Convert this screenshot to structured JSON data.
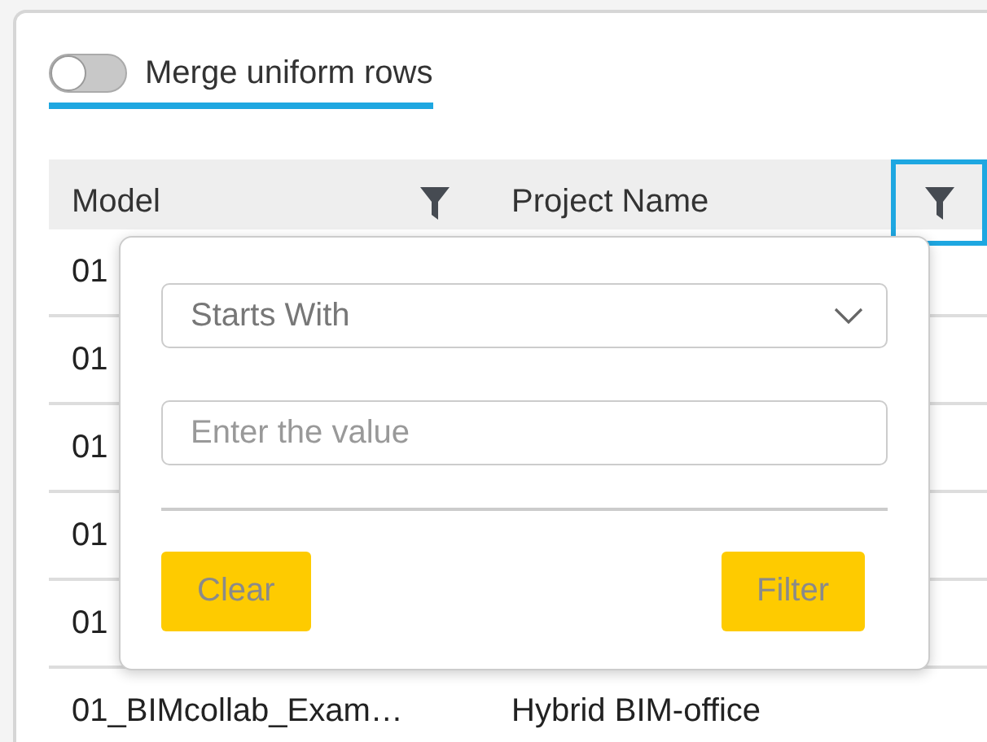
{
  "toggle": {
    "label": "Merge uniform rows",
    "on": false,
    "focused": true
  },
  "table": {
    "columns": [
      {
        "label": "Model",
        "filter_selected": false
      },
      {
        "label": "Project Name",
        "filter_selected": true
      }
    ],
    "rows": [
      [
        "01",
        ""
      ],
      [
        "01",
        ""
      ],
      [
        "01",
        ""
      ],
      [
        "01",
        ""
      ],
      [
        "01",
        ""
      ],
      [
        "01_BIMcollab_Exam…",
        "Hybrid BIM-office"
      ]
    ]
  },
  "filter_popup": {
    "condition": "Starts With",
    "value_placeholder": "Enter the value",
    "buttons": [
      "Clear",
      "Filter"
    ]
  }
}
